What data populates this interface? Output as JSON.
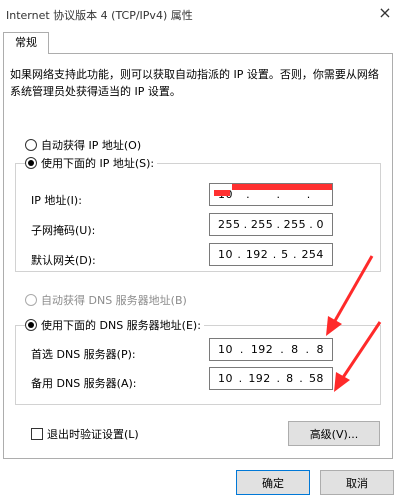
{
  "window": {
    "title": "Internet 协议版本 4 (TCP/IPv4) 属性",
    "close_glyph": "×"
  },
  "tabs": [
    {
      "label": "常规",
      "selected": true
    }
  ],
  "description": "如果网络支持此功能，则可以获取自动指派的 IP 设置。否则，你需要从网络系统管理员处获得适当的 IP 设置。",
  "ip_section": {
    "auto_label": "自动获得 IP 地址(O)",
    "manual_label": "使用下面的 IP 地址(S):",
    "selected": "manual",
    "fields": [
      {
        "label": "IP 地址(I):",
        "octets": [
          "10",
          "",
          "",
          ""
        ],
        "redacted": true
      },
      {
        "label": "子网掩码(U):",
        "octets": [
          "255",
          "255",
          "255",
          "0"
        ]
      },
      {
        "label": "默认网关(D):",
        "octets": [
          "10",
          "192",
          "5",
          "254"
        ]
      }
    ]
  },
  "dns_section": {
    "auto_label": "自动获得 DNS 服务器地址(B)",
    "auto_disabled": true,
    "manual_label": "使用下面的 DNS 服务器地址(E):",
    "selected": "manual",
    "fields": [
      {
        "label": "首选 DNS 服务器(P):",
        "octets": [
          "10",
          "192",
          "8",
          "8"
        ]
      },
      {
        "label": "备用 DNS 服务器(A):",
        "octets": [
          "10",
          "192",
          "8",
          "58"
        ]
      }
    ]
  },
  "validate_on_exit": {
    "label": "退出时验证设置(L)",
    "checked": false
  },
  "buttons": {
    "advanced": "高级(V)...",
    "ok": "确定",
    "cancel": "取消"
  },
  "annotations": {
    "arrow_color": "#ff2a2a",
    "redaction_color": "#ff3030"
  }
}
